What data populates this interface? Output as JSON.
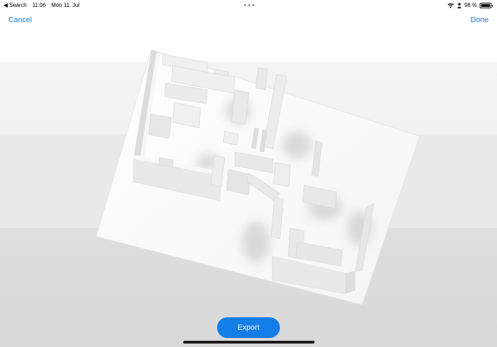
{
  "status_bar": {
    "back_app": "◀ Search",
    "time": "11:06",
    "date": "Mon 11. Jul",
    "battery": "98 %",
    "battery_level": 0.98
  },
  "nav": {
    "cancel_label": "Cancel",
    "done_label": "Done"
  },
  "export_label": "Export",
  "colors": {
    "accent": "#137de8",
    "link": "#1b7de6"
  }
}
